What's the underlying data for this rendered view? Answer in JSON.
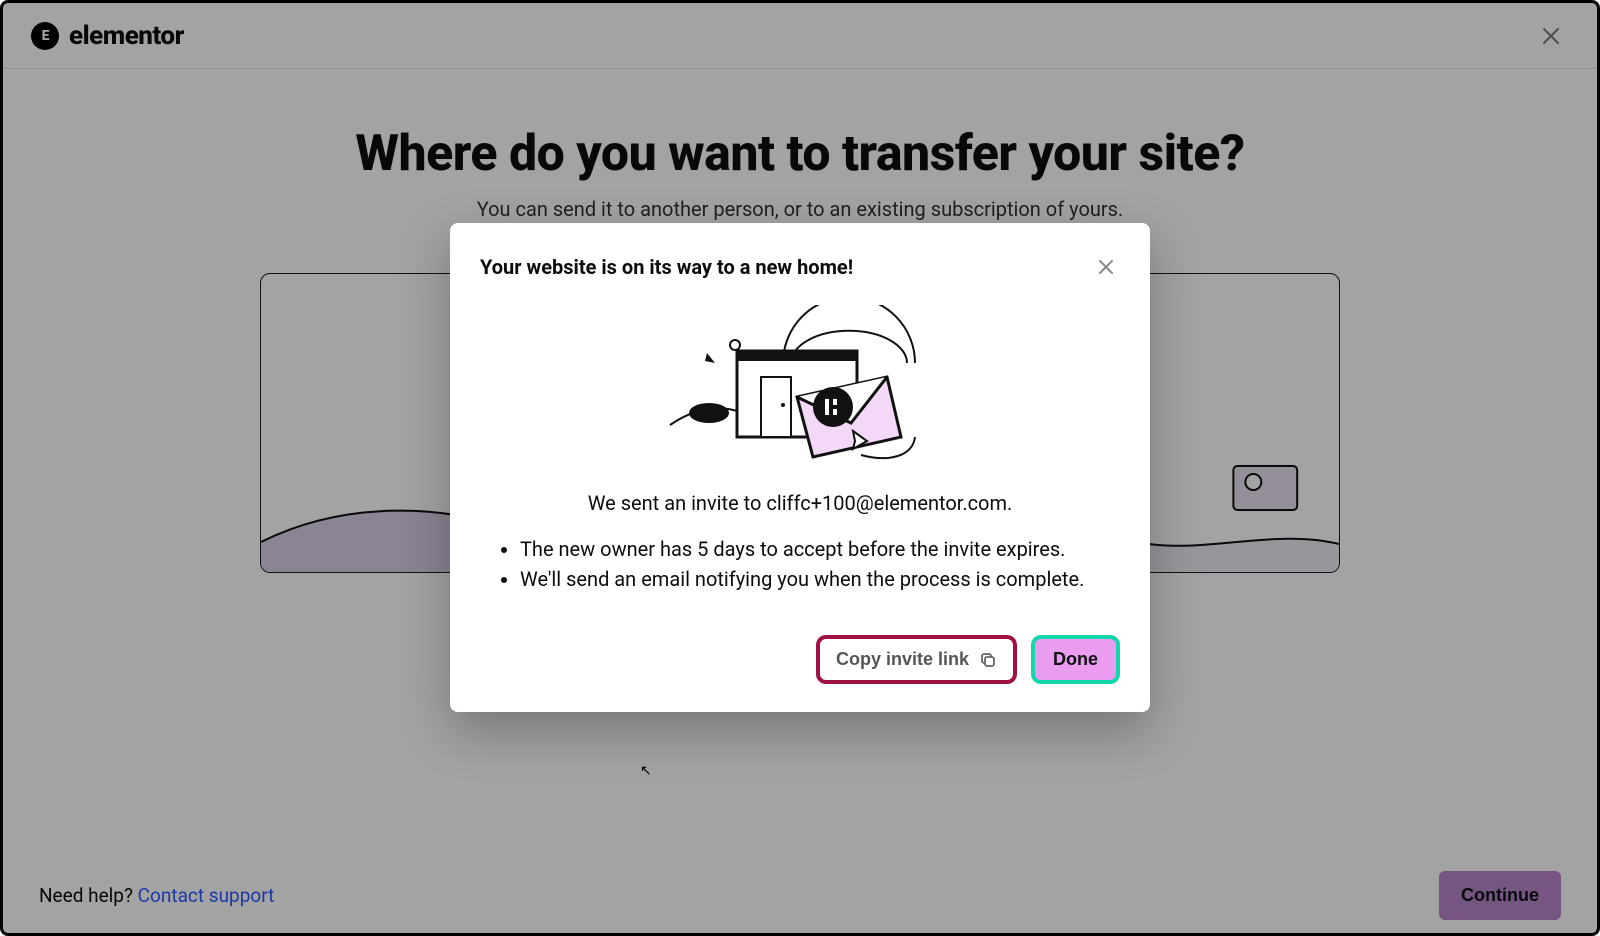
{
  "header": {
    "brand": "elementor",
    "brand_mark": "E"
  },
  "page": {
    "title": "Where do you want to transfer your site?",
    "subtitle": "You can send it to another person, or to an existing subscription of yours."
  },
  "footer": {
    "help_prefix": "Need help? ",
    "help_link": "Contact support",
    "continue_label": "Continue"
  },
  "modal": {
    "title": "Your website is on its way to a new home!",
    "sent_line": "We sent an invite to cliffc+100@elementor.com.",
    "bullets": [
      "The new owner has 5 days to accept before the invite expires.",
      "We'll send an email notifying you when the process is complete."
    ],
    "copy_label": "Copy invite link",
    "done_label": "Done"
  },
  "colors": {
    "scrim": "rgba(0,0,0,0.36)",
    "accent_purple": "#ba86cc",
    "highlight_magenta_border": "#a11045",
    "highlight_teal_border": "#13d6aa",
    "highlight_pink_fill": "#ea9cf0",
    "link": "#2b5cff"
  }
}
